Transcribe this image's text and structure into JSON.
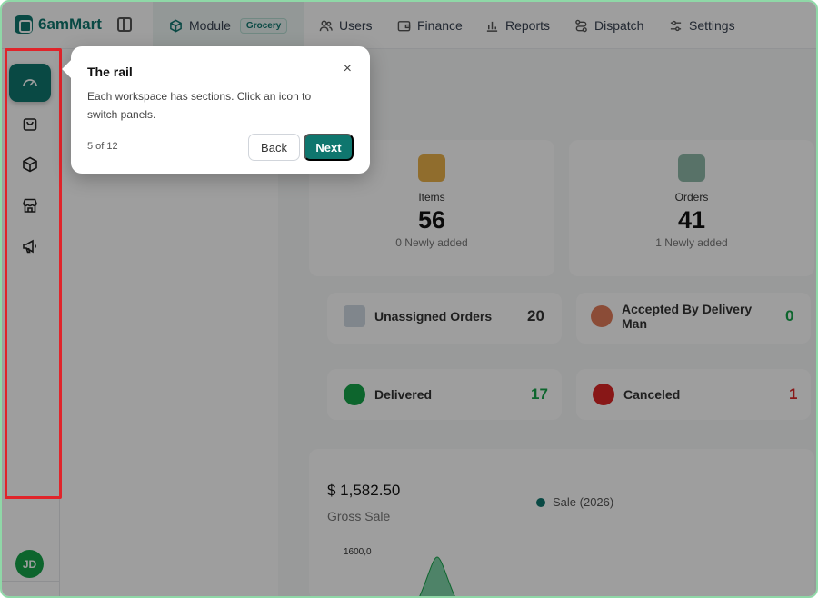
{
  "brand": {
    "name": "6amMart"
  },
  "topnav": {
    "module_label": "Module",
    "module_badge": "Grocery",
    "items": [
      {
        "label": "Users",
        "icon": "users-icon"
      },
      {
        "label": "Finance",
        "icon": "wallet-icon"
      },
      {
        "label": "Reports",
        "icon": "bar-chart-icon"
      },
      {
        "label": "Dispatch",
        "icon": "route-icon"
      },
      {
        "label": "Settings",
        "icon": "sliders-icon"
      }
    ]
  },
  "rail": {
    "items": [
      "dashboard-gauge-icon",
      "shopping-bag-icon",
      "package-icon",
      "store-icon",
      "megaphone-icon"
    ],
    "user_initials": "JD"
  },
  "dashboard": {
    "items": {
      "label": "Items",
      "value": "56",
      "sub": "0 Newly added"
    },
    "orders": {
      "label": "Orders",
      "value": "41",
      "sub": "1 Newly added"
    },
    "unassigned": {
      "label": "Unassigned Orders",
      "value": "20"
    },
    "accepted": {
      "label": "Accepted By Delivery Man",
      "value": "0"
    },
    "delivered": {
      "label": "Delivered",
      "value": "17"
    },
    "canceled": {
      "label": "Canceled",
      "value": "1"
    },
    "gross_amount": "$ 1,582.50",
    "gross_label": "Gross Sale",
    "legend": "Sale (2026)",
    "ytick": "1600,0"
  },
  "tour": {
    "title": "The rail",
    "body": "Each workspace has sections. Click an icon to switch panels.",
    "step": "5 of 12",
    "back": "Back",
    "next": "Next",
    "close": "×"
  },
  "colors": {
    "accent": "#0f766e",
    "highlight": "#e0242a",
    "success": "#16a34a",
    "danger": "#dc2626"
  }
}
